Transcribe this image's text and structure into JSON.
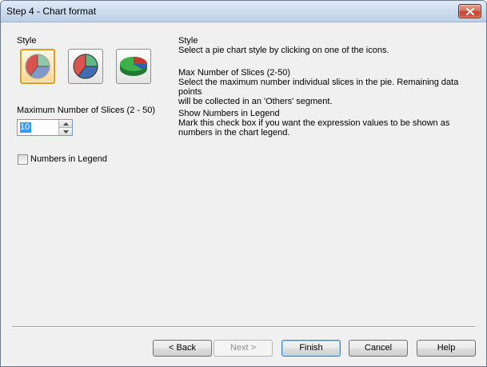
{
  "window": {
    "title": "Step 4 - Chart format",
    "close_icon": "close-icon"
  },
  "style_section": {
    "label": "Style",
    "icons": [
      {
        "name": "pie-style-1-icon",
        "selected": true
      },
      {
        "name": "pie-style-2-icon",
        "selected": false
      },
      {
        "name": "pie-style-3d-icon",
        "selected": false
      }
    ]
  },
  "slices": {
    "label": "Maximum Number of Slices (2 - 50)",
    "value": "10"
  },
  "legend_checkbox": {
    "label": "Numbers in Legend",
    "checked": false
  },
  "help": {
    "style_title": "Style",
    "style_text": "Select a pie chart style by clicking on one of the icons.",
    "max_title": "Max Number of Slices (2-50)",
    "max_text_1": "Select the maximum number individual slices in the pie. Remaining data points",
    "max_text_2": "will be collected in an 'Others' segment.",
    "legend_title": "Show Numbers in Legend",
    "legend_text_1": "Mark this check box if you want the expression values to be shown as",
    "legend_text_2": "numbers in the chart legend."
  },
  "buttons": {
    "back": "< Back",
    "next": "Next >",
    "finish": "Finish",
    "cancel": "Cancel",
    "help": "Help"
  },
  "colors": {
    "selected_icon_border": "#e39a1e",
    "titlebar": "#cfdeef",
    "dialog_bg": "#f0f0f0"
  }
}
